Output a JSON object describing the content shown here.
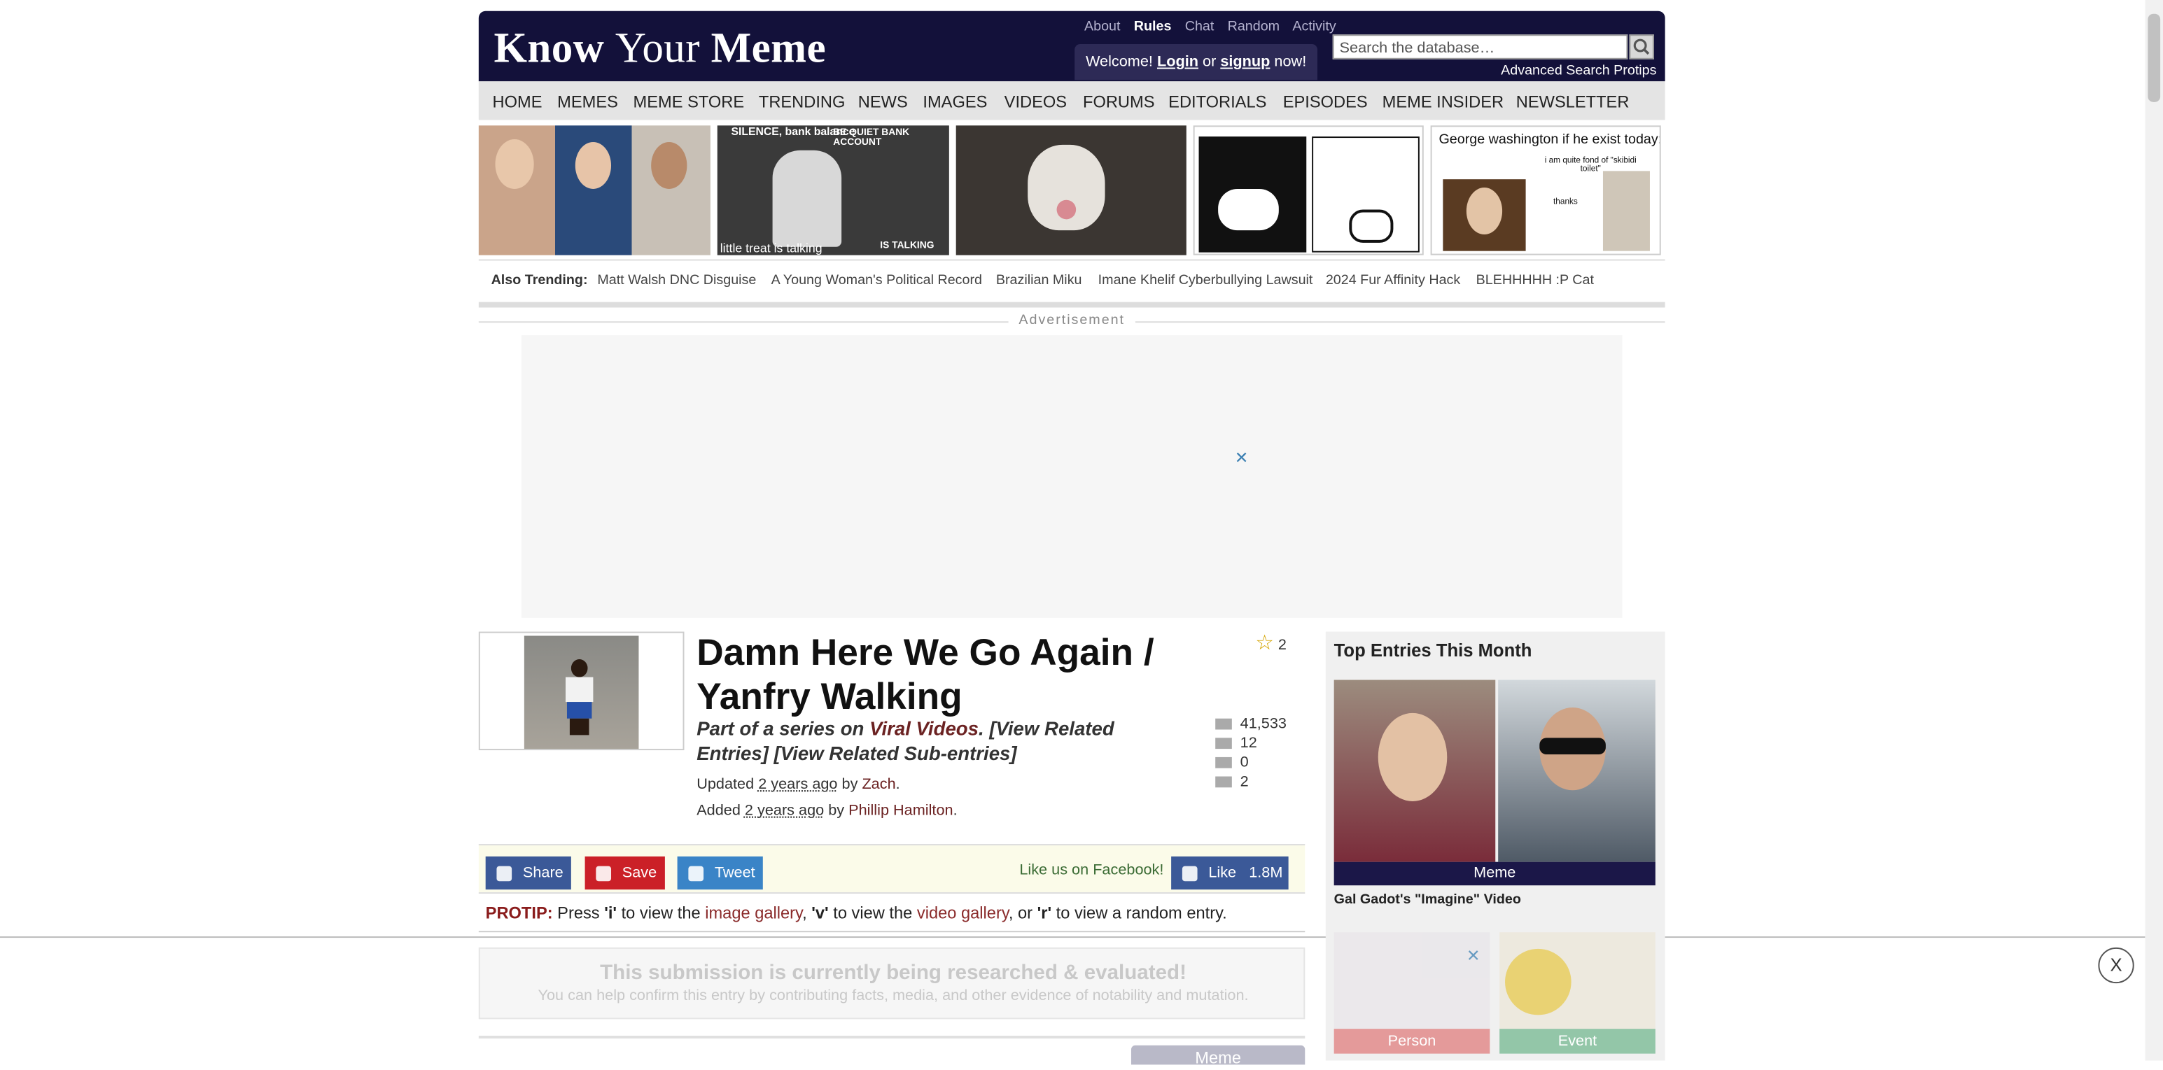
{
  "header": {
    "logo_part1": "Know ",
    "logo_part2": "Your ",
    "logo_part3": "Meme",
    "top_links": [
      "About",
      "Rules",
      "Chat",
      "Random",
      "Activity"
    ],
    "welcome_prefix": "Welcome! ",
    "login": "Login",
    "or": " or ",
    "signup": "signup",
    "now": " now!",
    "search_placeholder": "Search the database…",
    "advanced_search": "Advanced Search Protips"
  },
  "nav": [
    "HOME",
    "MEMES",
    "MEME STORE",
    "TRENDING",
    "NEWS",
    "IMAGES",
    "VIDEOS",
    "FORUMS",
    "EDITORIALS",
    "EPISODES",
    "MEME INSIDER",
    "NEWSLETTER"
  ],
  "banner": {
    "thumb2_caption": "SILENCE, bank balance",
    "thumb2_caption2": "BE QUIET BANK ACCOUNT",
    "thumb2_caption3": "little treat is talking",
    "thumb2_caption4": "IS TALKING",
    "thumb5_caption": "George washington if he exist today:",
    "thumb5_bubble1": "i am quite fond of \"skibidi toilet\"",
    "thumb5_bubble2": "thanks"
  },
  "trending": {
    "label": "Also Trending:",
    "items": [
      "Matt Walsh DNC Disguise",
      "A Young Woman's Political Record",
      "Brazilian Miku",
      "Imane Khelif Cyberbullying Lawsuit",
      "2024 Fur Affinity Hack",
      "BLEHHHHH :P Cat"
    ]
  },
  "ad": {
    "label": "Advertisement",
    "close": "✕"
  },
  "entry": {
    "title": "Damn Here We Go Again / Yanfry Walking",
    "series_prefix": "Part of a series on ",
    "series_link": "Viral Videos",
    "series_suffix": ". [View Related Entries] [View Related Sub-entries]",
    "updated_prefix": "Updated ",
    "updated_time": "2 years ago",
    "updated_by": " by ",
    "updated_author": "Zach",
    "added_prefix": "Added ",
    "added_time": "2 years ago",
    "added_by": " by ",
    "added_author": "Phillip Hamilton",
    "favorites": "2",
    "stats": {
      "views": "41,533",
      "videos": "12",
      "photos": "0",
      "comments": "2"
    }
  },
  "share": {
    "facebook": "Share",
    "pinterest": "Save",
    "twitter": "Tweet",
    "like_text": "Like us on Facebook!",
    "like_button": "Like",
    "like_count": "1.8M"
  },
  "protip": {
    "label": "PROTIP:",
    "t1": " Press ",
    "k1": "'i'",
    "t2": " to view the ",
    "l1": "image gallery",
    "t3": ", ",
    "k2": "'v'",
    "t4": " to view the ",
    "l2": "video gallery",
    "t5": ", or ",
    "k3": "'r'",
    "t6": " to view a random entry."
  },
  "research": {
    "heading": "This submission is currently being researched & evaluated!",
    "sub": "You can help confirm this entry by contributing facts, media, and other evidence of notability and mutation."
  },
  "meme_tab": "Meme",
  "sticky_close": "X",
  "sidebar": {
    "heading": "Top Entries This Month",
    "top_category": "Meme",
    "top_title": "Gal Gadot's \"Imagine\" Video",
    "cat_person": "Person",
    "cat_event": "Event",
    "close": "✕"
  },
  "colors": {
    "header_bg": "#13113a",
    "accent_link": "#6b2222",
    "facebook": "#3b5998",
    "pinterest": "#cb2027",
    "twitter": "#3a84c7"
  }
}
